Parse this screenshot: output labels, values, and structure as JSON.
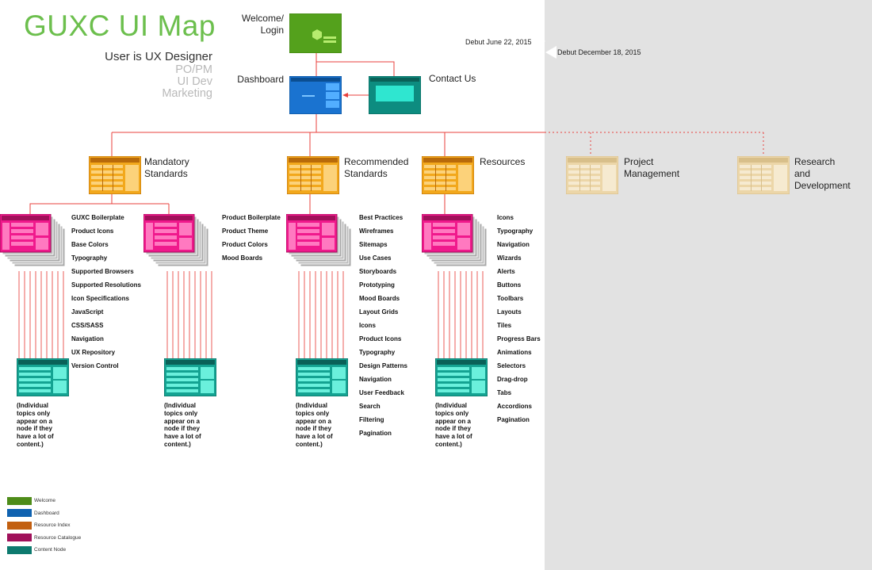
{
  "title": "GUXC UI Map",
  "roles": {
    "active": "User is UX Designer",
    "others": [
      "PO/PM",
      "UI Dev",
      "Marketing"
    ]
  },
  "nodes": {
    "welcome": "Welcome/\nLogin",
    "dashboard": "Dashboard",
    "contact": "Contact Us",
    "mandatory": "Mandatory\nStandards",
    "recommended": "Recommended\nStandards",
    "resources": "Resources",
    "project_management": "Project\nManagement",
    "research": "Research\nand\nDevelopment"
  },
  "debuts": [
    "Debut June 22, 2015",
    "Debut December 18, 2015"
  ],
  "lists": {
    "mandatory_a": [
      "GUXC Boilerplate",
      "Product Icons",
      "Base Colors",
      "Typography",
      "Supported Browsers",
      "Supported Resolutions",
      "Icon Specifications",
      "JavaScript",
      "CSS/SASS",
      "Navigation",
      "UX Repository",
      "Version Control"
    ],
    "mandatory_b": [
      "Product Boilerplate",
      "Product Theme",
      "Product Colors",
      "Mood Boards"
    ],
    "recommended": [
      "Best Practices",
      "Wireframes",
      "Sitemaps",
      "Use Cases",
      "Storyboards",
      "Prototyping",
      "Mood Boards",
      "Layout Grids",
      "Icons",
      "Product Icons",
      "Typography",
      "Design Patterns",
      "Navigation",
      "User Feedback",
      "Search",
      "Filtering",
      "Pagination"
    ],
    "resources": [
      "Icons",
      "Typography",
      "Navigation",
      "Wizards",
      "Alerts",
      "Buttons",
      "Toolbars",
      "Layouts",
      "Tiles",
      "Progress Bars",
      "Animations",
      "Selectors",
      "Drag-drop",
      "Tabs",
      "Accordions",
      "Pagination"
    ]
  },
  "content_note": "(Individual topics only appear on a node if they have a lot of content.)",
  "legend": [
    {
      "label": "Welcome",
      "color": "#4e8c19"
    },
    {
      "label": "Dashboard",
      "color": "#0f62b0"
    },
    {
      "label": "Resource Index",
      "color": "#c25f10"
    },
    {
      "label": "Resource Catalogue",
      "color": "#a0105a"
    },
    {
      "label": "Content Node",
      "color": "#0d7a6f"
    }
  ],
  "colors": {
    "title": "#6cbf4d",
    "connector": "#e8403c",
    "future_panel": "#e2e2e2",
    "welcome": "#54a11c",
    "dashboard": "#1a73d0",
    "contact": "#0d8c80",
    "index": "#f2a81c",
    "index_faded": "#ecd6a8",
    "catalogue": "#f0198c",
    "content": "#14a392"
  },
  "icons": [
    "welcome-screen-icon",
    "dashboard-screen-icon",
    "contact-screen-icon",
    "resource-index-icon",
    "resource-catalogue-stack-icon",
    "content-node-icon"
  ]
}
